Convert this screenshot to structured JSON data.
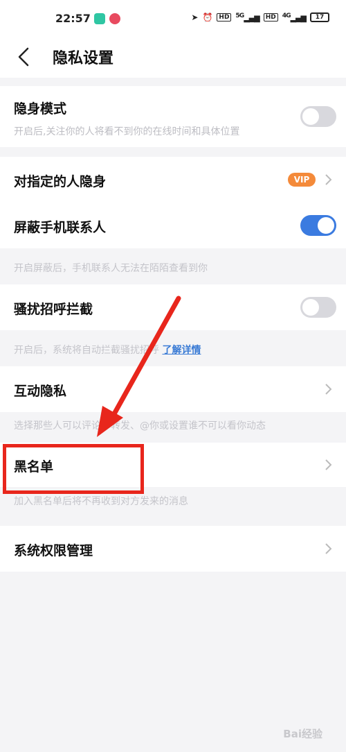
{
  "status_bar": {
    "time": "22:57",
    "hd1": "HD",
    "net1": "5G",
    "hd2": "HD",
    "net2": "4G",
    "battery": "17"
  },
  "header": {
    "title": "隐私设置"
  },
  "rows": {
    "stealth": {
      "label": "隐身模式",
      "desc": "开启后,关注你的人将看不到你的在线时间和具体位置",
      "toggle": "off"
    },
    "specific": {
      "label": "对指定的人隐身",
      "badge": "VIP"
    },
    "block_contacts": {
      "label": "屏蔽手机联系人",
      "toggle": "on",
      "note": "开启屏蔽后，手机联系人无法在陌陌查看到你"
    },
    "harass": {
      "label": "骚扰招呼拦截",
      "toggle": "off",
      "note": "开启后，系统将自动拦截骚扰招呼",
      "link": "了解详情"
    },
    "interact": {
      "label": "互动隐私",
      "note": "选择那些人可以评论、转发、@你或设置谁不可以看你动态"
    },
    "blacklist": {
      "label": "黑名单",
      "note": "加入黑名单后将不再收到对方发来的消息"
    },
    "system": {
      "label": "系统权限管理"
    }
  },
  "watermark": "Bai经验",
  "colors": {
    "accent": "#3b7be0",
    "vip": "#f48a3a",
    "annotation": "#e8261c"
  }
}
